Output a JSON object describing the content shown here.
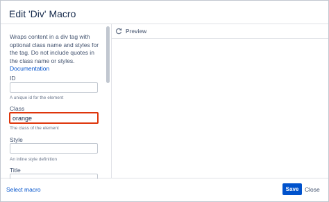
{
  "dialog": {
    "title": "Edit 'Div' Macro"
  },
  "form": {
    "description": "Wraps content in a div tag with optional class name and styles for the tag. Do not include quotes in the class name or styles.",
    "documentation_link": "Documentation",
    "fields": {
      "id": {
        "label": "ID",
        "value": "",
        "help": "A unique id for the element"
      },
      "class": {
        "label": "Class",
        "value": "orange",
        "help": "The class of the element"
      },
      "style": {
        "label": "Style",
        "value": "",
        "help": "An inline style definition"
      },
      "title": {
        "label": "Title",
        "value": ""
      }
    }
  },
  "preview": {
    "label": "Preview",
    "icon": "refresh-icon"
  },
  "footer": {
    "select_macro": "Select macro",
    "save_label": "Save",
    "close_label": "Close"
  },
  "colors": {
    "primary": "#0052cc",
    "highlight_border": "#de350b"
  }
}
